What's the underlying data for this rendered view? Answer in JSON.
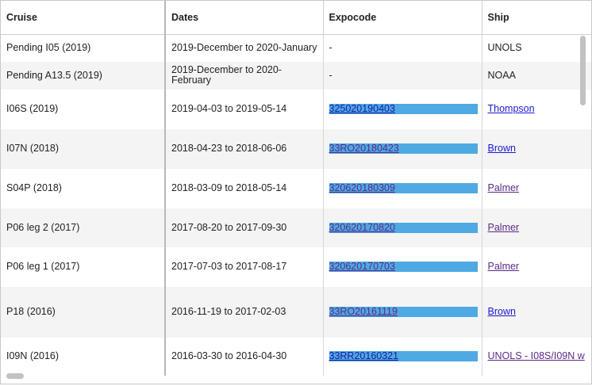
{
  "headers": {
    "cruise": "Cruise",
    "dates": "Dates",
    "expocode": "Expocode",
    "ship": "Ship"
  },
  "colors": {
    "link_bg": "#4fa9e3",
    "link": "#1a1ad0",
    "visited_link": "#5b2a86"
  },
  "rows": [
    {
      "cruise": "Pending I05 (2019)",
      "dates": "2019-December to 2020-January",
      "expocode": "-",
      "ship": "UNOLS"
    },
    {
      "cruise": "Pending A13.5 (2019)",
      "dates": "2019-December to 2020-February",
      "expocode": "-",
      "ship": "NOAA"
    },
    {
      "cruise": "I06S (2019)",
      "dates": "2019-04-03 to 2019-05-14",
      "expocode": "325020190403",
      "ship": "Thompson"
    },
    {
      "cruise": "I07N (2018)",
      "dates": "2018-04-23 to 2018-06-06",
      "expocode": "33RO20180423",
      "ship": "Brown"
    },
    {
      "cruise": "S04P (2018)",
      "dates": "2018-03-09 to 2018-05-14",
      "expocode": "320620180309",
      "ship": "Palmer"
    },
    {
      "cruise": "P06 leg 2 (2017)",
      "dates": "2017-08-20 to 2017-09-30",
      "expocode": "320620170820",
      "ship": "Palmer"
    },
    {
      "cruise": "P06 leg 1 (2017)",
      "dates": "2017-07-03 to 2017-08-17",
      "expocode": "320620170703",
      "ship": "Palmer"
    },
    {
      "cruise": "P18 (2016)",
      "dates": "2016-11-19 to 2017-02-03",
      "expocode": "33RO20161119",
      "ship": "Brown"
    },
    {
      "cruise": "I09N (2016)",
      "dates": "2016-03-30 to 2016-04-30",
      "expocode": "33RR20160321",
      "ship": "UNOLS - I08S/I09N w"
    }
  ]
}
